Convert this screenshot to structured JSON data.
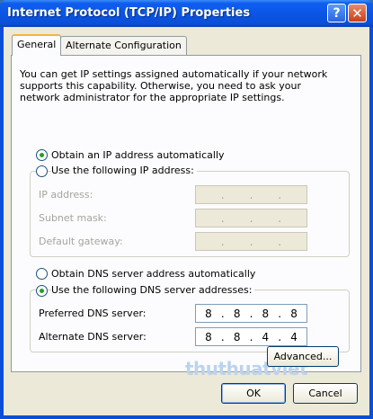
{
  "window": {
    "title": "Internet Protocol (TCP/IP) Properties",
    "help_glyph": "?",
    "close_glyph": "✕"
  },
  "tabs": [
    {
      "label": "General",
      "active": true
    },
    {
      "label": "Alternate Configuration",
      "active": false
    }
  ],
  "general": {
    "description": "You can get IP settings assigned automatically if your network supports this capability. Otherwise, you need to ask your network administrator for the appropriate IP settings.",
    "ip": {
      "auto_label": "Obtain an IP address automatically",
      "manual_label": "Use the following IP address:",
      "selected": "auto",
      "fields": [
        {
          "label": "IP address:",
          "octets": [
            "",
            "",
            "",
            ""
          ]
        },
        {
          "label": "Subnet mask:",
          "octets": [
            "",
            "",
            "",
            ""
          ]
        },
        {
          "label": "Default gateway:",
          "octets": [
            "",
            "",
            "",
            ""
          ]
        }
      ]
    },
    "dns": {
      "auto_label": "Obtain DNS server address automatically",
      "manual_label": "Use the following DNS server addresses:",
      "selected": "manual",
      "fields": [
        {
          "label": "Preferred DNS server:",
          "octets": [
            "8",
            "8",
            "8",
            "8"
          ]
        },
        {
          "label": "Alternate DNS server:",
          "octets": [
            "8",
            "8",
            "4",
            "4"
          ]
        }
      ]
    },
    "advanced_label": "Advanced..."
  },
  "watermark": "thuthuatviet",
  "footer": {
    "ok_label": "OK",
    "cancel_label": "Cancel"
  },
  "colors": {
    "title_bar": "#0a4fd8",
    "radio_dot": "#21a121",
    "tab_highlight": "#f5b33e"
  }
}
